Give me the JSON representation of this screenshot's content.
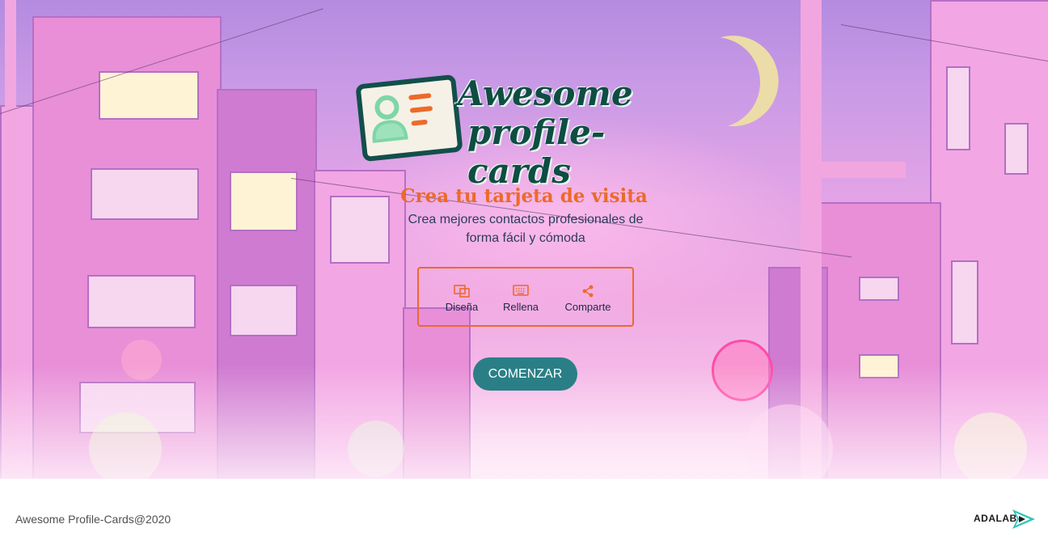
{
  "logo": {
    "line1": "Awesome",
    "line2": "profile-cards"
  },
  "hero": {
    "headline": "Crea tu tarjeta de visita",
    "subheadline": "Crea mejores contactos profesionales de forma fácil y cómoda"
  },
  "steps": [
    {
      "label": "Diseña",
      "icon": "layout-icon"
    },
    {
      "label": "Rellena",
      "icon": "keyboard-icon"
    },
    {
      "label": "Comparte",
      "icon": "share-icon"
    }
  ],
  "cta": {
    "label": "COMENZAR"
  },
  "footer": {
    "copyright": "Awesome Profile-Cards@2020",
    "brand": "ADALAB"
  },
  "colors": {
    "accent": "#ec6a2a",
    "button": "#2a7f86",
    "logo": "#0f4d43",
    "text": "#2b3d5c"
  }
}
